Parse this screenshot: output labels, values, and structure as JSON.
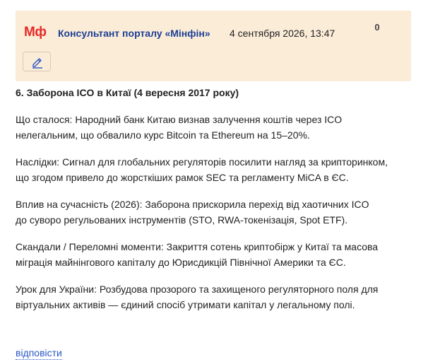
{
  "comment": {
    "logo_text": "Мф",
    "author": "Консультант порталу «Мінфін»",
    "date": "4 сентября 2026, 13:47",
    "score": "0",
    "edit_icon": "pencil-icon",
    "heading": "6. Заборона ICO в Китаї (4 вересня 2017 року)",
    "paragraphs": [
      {
        "lines": [
          "Що сталося: Народний банк Китаю визнав залучення коштів через ICO",
          "нелегальним, що обвалило курс Bitcoin та Ethereum на 15–20%."
        ]
      },
      {
        "lines": [
          "Наслідки: Сигнал для глобальних регуляторів посилити нагляд за крипторинком,",
          "що згодом привело до жорсткіших рамок SEC та регламенту MiCA в ЄС."
        ]
      },
      {
        "lines": [
          "Вплив на сучасність (2026): Заборона прискорила перехід від хаотичних ICO",
          "до суворо регульованих інструментів (STO, RWA-токенізація, Spot ETF)."
        ]
      },
      {
        "lines": [
          "Скандали / Переломні моменти: Закриття сотень криптобірж у Китаї та масова",
          "міграція майнінгового капіталу до Юрисдикцій Північної Америки та ЄС."
        ]
      },
      {
        "lines": [
          "Урок для України: Розбудова прозорого та захищеного регуляторного поля для",
          "віртуальних активів — єдиний спосіб утримати капітал у легальному полі."
        ]
      }
    ],
    "reply_label": "відповісти"
  },
  "colors": {
    "header_bg": "#fbecd8",
    "logo": "#e52929",
    "author": "#1c3f94",
    "link": "#2a56c6"
  }
}
